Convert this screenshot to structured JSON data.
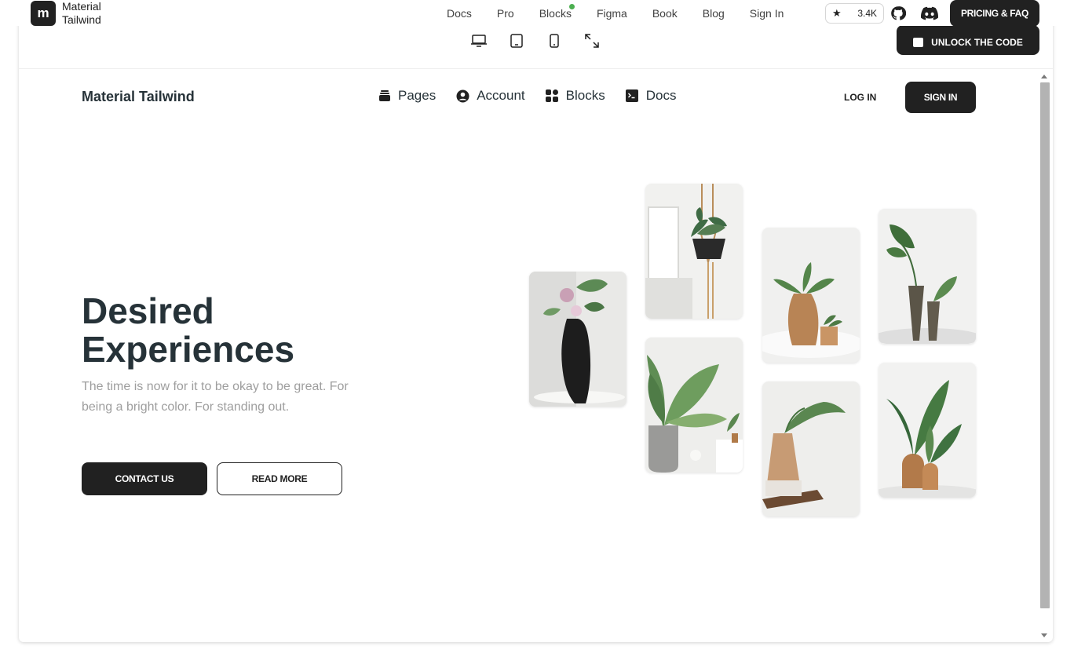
{
  "site": {
    "brand_mark": "m",
    "brand_name": "Material Tailwind",
    "nav": [
      "Docs",
      "Pro",
      "Blocks",
      "Figma",
      "Book",
      "Blog",
      "Sign In"
    ],
    "stars": "3.4K",
    "pricing_label": "PRICING & FAQ"
  },
  "preview": {
    "unlock_label": "UNLOCK THE CODE"
  },
  "page": {
    "brand": "Material Tailwind",
    "menu": [
      "Pages",
      "Account",
      "Blocks",
      "Docs"
    ],
    "login_label": "LOG IN",
    "signin_label": "SIGN IN",
    "hero_title": "Desired Experiences",
    "hero_text": "The time is now for it to be okay to be great. For being a bright color. For standing out.",
    "contact_label": "CONTACT US",
    "read_more_label": "READ MORE"
  },
  "icons": {
    "devices": [
      "desktop-icon",
      "tablet-icon",
      "mobile-icon",
      "fullscreen-icon"
    ],
    "menu": [
      "rectangle-stack-icon",
      "user-circle-icon",
      "squares-icon",
      "terminal-icon"
    ]
  },
  "colors": {
    "primary": "#212121",
    "heading": "#263238",
    "muted": "#9e9e9e",
    "status_dot": "#4caf50"
  }
}
